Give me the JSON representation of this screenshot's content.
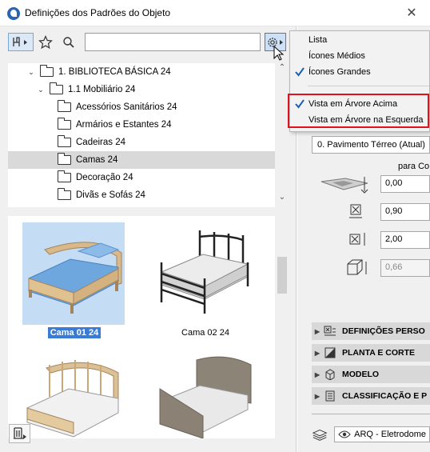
{
  "window": {
    "title": "Definições dos Padrões do Objeto",
    "close_glyph": "✕"
  },
  "toolbar": {
    "library_icon": "library-chair-icon",
    "favorites_icon": "star-icon",
    "search_icon": "magnifier-icon",
    "search_value": "",
    "settings_icon": "gear-icon"
  },
  "tree": {
    "items": [
      {
        "label": "1. BIBLIOTECA BÁSICA 24",
        "level": 0,
        "expanded": true
      },
      {
        "label": "1.1 Mobiliário 24",
        "level": 1,
        "expanded": true
      },
      {
        "label": "Acessórios Sanitários 24",
        "level": 2
      },
      {
        "label": "Armários e Estantes 24",
        "level": 2
      },
      {
        "label": "Cadeiras 24",
        "level": 2
      },
      {
        "label": "Camas 24",
        "level": 2,
        "selected": true
      },
      {
        "label": "Decoração 24",
        "level": 2
      },
      {
        "label": "Divãs e Sofás 24",
        "level": 2
      }
    ]
  },
  "thumbnails": [
    {
      "caption": "Cama 01 24",
      "selected": true
    },
    {
      "caption": "Cama 02 24",
      "selected": false
    },
    {
      "caption": "",
      "selected": false
    },
    {
      "caption": "",
      "selected": false
    }
  ],
  "view_menu": {
    "items": [
      {
        "label": "Lista",
        "checked": false
      },
      {
        "label": "Ícones Médios",
        "checked": false
      },
      {
        "label": "Ícones Grandes",
        "checked": true
      },
      {
        "label": "Vista em Árvore Acima",
        "checked": true
      },
      {
        "label": "Vista em Árvore na Esquerda",
        "checked": false
      }
    ]
  },
  "right_panel": {
    "story": "0. Pavimento Térreo (Atual)",
    "header": "para Co",
    "fields": [
      {
        "name": "elevation",
        "value": "0,00"
      },
      {
        "name": "width",
        "value": "0,90"
      },
      {
        "name": "length",
        "value": "2,00"
      },
      {
        "name": "height",
        "value": "0,66",
        "disabled": true
      }
    ],
    "sections": [
      {
        "label": "DEFINIÇÕES PERSO"
      },
      {
        "label": "PLANTA E CORTE"
      },
      {
        "label": "MODELO"
      },
      {
        "label": "CLASSIFICAÇÃO E P"
      }
    ],
    "layer": "ARQ - Eletrodome"
  },
  "colors": {
    "accent": "#3a7bd5",
    "highlight": "#e0121c",
    "selection": "#c5dcf5"
  }
}
